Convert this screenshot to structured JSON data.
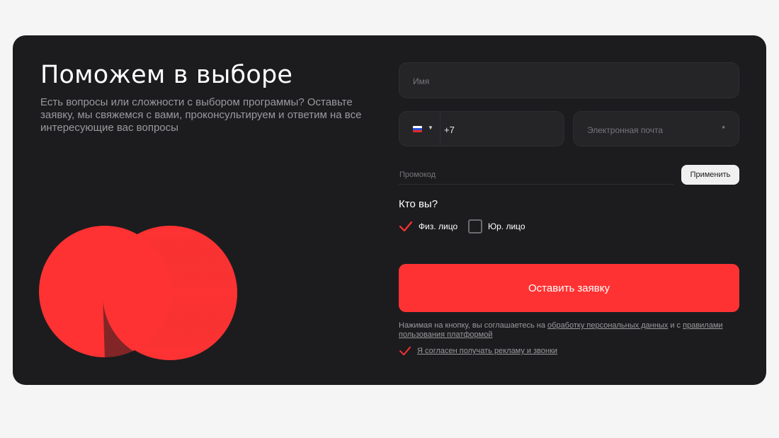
{
  "heading": {
    "title": "Поможем в выборе",
    "subtitle": "Есть вопросы или сложности с выбором программы? Оставьте заявку, мы свяжемся с вами, проконсультируем и ответим на все интересующие вас вопросы"
  },
  "form": {
    "name_placeholder": "Имя",
    "phone_country": "RU",
    "phone_code": "+7",
    "email_placeholder": "Электронная почта",
    "email_required_mark": "*",
    "promo_placeholder": "Промокод",
    "apply_label": "Применить",
    "who_label": "Кто вы?",
    "options": [
      {
        "label": "Физ. лицо",
        "checked": true
      },
      {
        "label": "Юр. лицо",
        "checked": false
      }
    ],
    "submit_label": "Оставить заявку",
    "consent_prefix": "Нажимая на кнопку, вы соглашаетесь на ",
    "consent_link1": "обработку персональных данных",
    "consent_mid": " и с ",
    "consent_link2": "правилами пользования платформой",
    "ads_label": "Я согласен получать рекламу и звонки",
    "ads_checked": true
  },
  "colors": {
    "accent": "#ff3233",
    "card_bg": "#1c1c1e",
    "page_bg": "#f5f5f5",
    "field_bg": "#252528"
  },
  "icons": {
    "flag": "russia-flag-icon",
    "dropdown": "chevron-down-icon",
    "check": "checkmark-icon",
    "art": "overlapping-circles-graphic"
  }
}
